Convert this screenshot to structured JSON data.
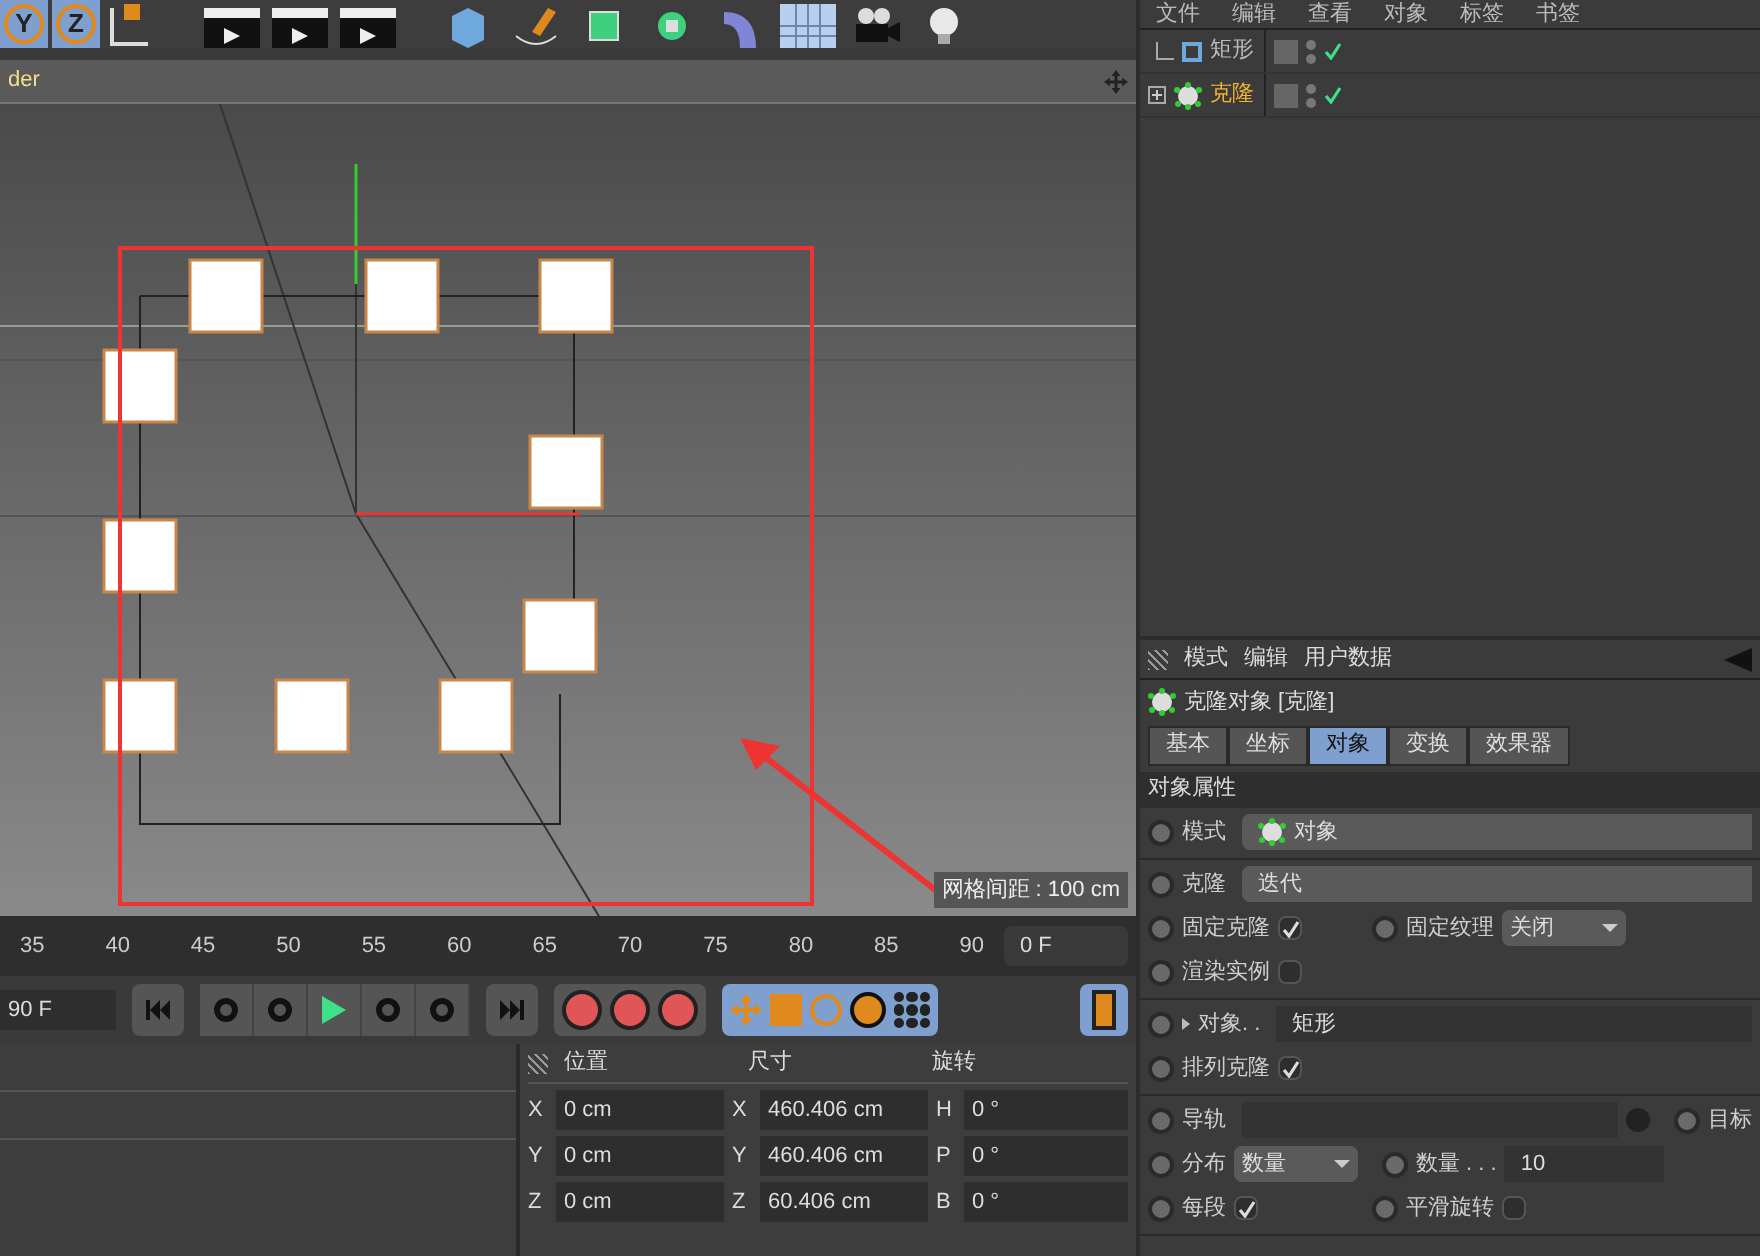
{
  "toolbar": {
    "axis_labels": [
      "Y",
      "Z"
    ]
  },
  "viewport": {
    "title": "der",
    "grid_label": "网格间距 : 100 cm"
  },
  "timeline": {
    "ticks": [
      "35",
      "40",
      "45",
      "50",
      "55",
      "60",
      "65",
      "70",
      "75",
      "80",
      "85",
      "90"
    ],
    "current_frame": "0 F",
    "end_frame": "90 F"
  },
  "coordinates": {
    "headers": [
      "位置",
      "尺寸",
      "旋转"
    ],
    "rows": [
      {
        "pos_axis": "X",
        "pos": "0 cm",
        "size_axis": "X",
        "size": "460.406 cm",
        "rot_axis": "H",
        "rot": "0 °"
      },
      {
        "pos_axis": "Y",
        "pos": "0 cm",
        "size_axis": "Y",
        "size": "460.406 cm",
        "rot_axis": "P",
        "rot": "0 °"
      },
      {
        "pos_axis": "Z",
        "pos": "0 cm",
        "size_axis": "Z",
        "size": "60.406 cm",
        "rot_axis": "B",
        "rot": "0 °"
      }
    ]
  },
  "object_manager": {
    "menu": [
      "文件",
      "编辑",
      "查看",
      "对象",
      "标签",
      "书签"
    ],
    "objects": [
      {
        "name": "矩形",
        "kind": "child",
        "selected": false
      },
      {
        "name": "克隆",
        "kind": "parent",
        "selected": true
      }
    ]
  },
  "attributes": {
    "menu": [
      "模式",
      "编辑",
      "用户数据"
    ],
    "title": "克隆对象 [克隆]",
    "tabs": [
      {
        "label": "基本",
        "selected": false
      },
      {
        "label": "坐标",
        "selected": false
      },
      {
        "label": "对象",
        "selected": true
      },
      {
        "label": "变换",
        "selected": false
      },
      {
        "label": "效果器",
        "selected": false
      }
    ],
    "section": "对象属性",
    "groups": [
      [
        [
          {
            "kind": "field",
            "label": "模式",
            "value": "对象",
            "icon": true
          }
        ]
      ],
      [
        [
          {
            "kind": "field",
            "label": "克隆",
            "value": "迭代",
            "icon": false
          }
        ],
        [
          {
            "kind": "check",
            "label": "固定克隆",
            "checked": true
          },
          {
            "kind": "select",
            "label": "固定纹理",
            "value": "关闭"
          }
        ],
        [
          {
            "kind": "check",
            "label": "渲染实例",
            "checked": false
          }
        ]
      ],
      [
        [
          {
            "kind": "link",
            "label": "对象. .",
            "value": "矩形"
          }
        ],
        [
          {
            "kind": "check",
            "label": "排列克隆",
            "checked": true
          }
        ]
      ],
      [
        [
          {
            "kind": "pick",
            "label": "导轨"
          },
          {
            "kind": "radio",
            "label": "目标"
          }
        ],
        [
          {
            "kind": "select",
            "label": "分布",
            "value": "数量"
          },
          {
            "kind": "number",
            "label": "数量 . . .",
            "value": "10"
          }
        ],
        [
          {
            "kind": "check",
            "label": "每段",
            "checked": true
          },
          {
            "kind": "check",
            "label": "平滑旋转",
            "checked": false
          }
        ]
      ]
    ]
  }
}
